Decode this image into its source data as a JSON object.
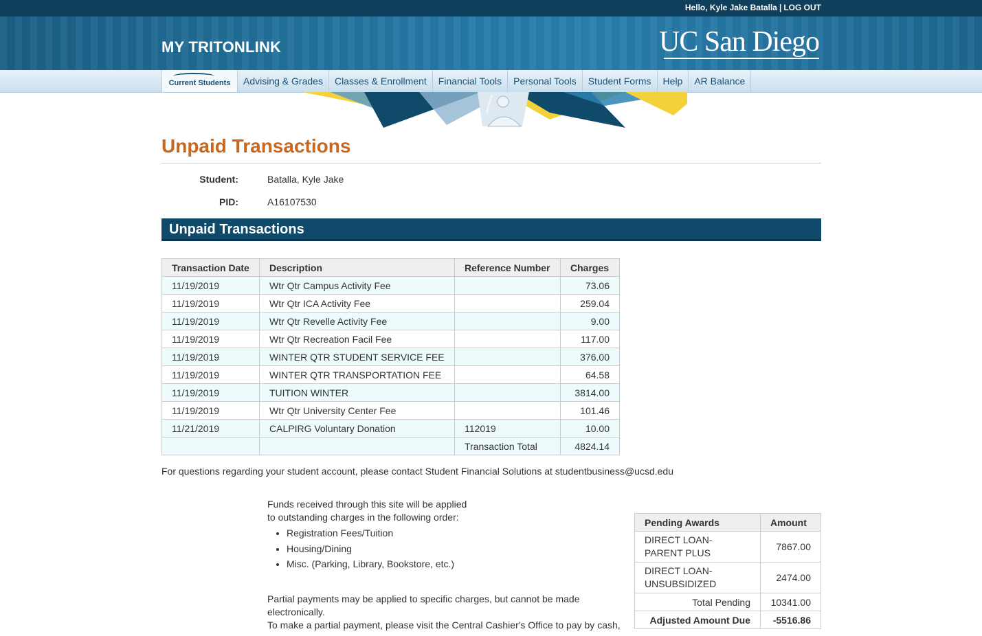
{
  "header": {
    "greeting": "Hello, Kyle Jake Batalla",
    "separator": "|",
    "logout": "LOG OUT",
    "app_title": "MY TRITONLINK",
    "logo_text": "UC San Diego"
  },
  "nav": {
    "items": [
      {
        "label": "Current Students"
      },
      {
        "label": "Advising & Grades"
      },
      {
        "label": "Classes & Enrollment"
      },
      {
        "label": "Financial Tools"
      },
      {
        "label": "Personal Tools"
      },
      {
        "label": "Student Forms"
      },
      {
        "label": "Help"
      },
      {
        "label": "AR Balance"
      }
    ]
  },
  "page": {
    "title": "Unpaid Transactions",
    "student_label": "Student:",
    "student_value": "Batalla, Kyle Jake",
    "pid_label": "PID:",
    "pid_value": "A16107530",
    "section_title": "Unpaid Transactions"
  },
  "transactions": {
    "headers": [
      "Transaction Date",
      "Description",
      "Reference Number",
      "Charges"
    ],
    "rows": [
      {
        "date": "11/19/2019",
        "description": "Wtr Qtr Campus Activity Fee",
        "reference": "",
        "charge": "73.06"
      },
      {
        "date": "11/19/2019",
        "description": "Wtr Qtr ICA Activity Fee",
        "reference": "",
        "charge": "259.04"
      },
      {
        "date": "11/19/2019",
        "description": "Wtr Qtr Revelle Activity Fee",
        "reference": "",
        "charge": "9.00"
      },
      {
        "date": "11/19/2019",
        "description": "Wtr Qtr Recreation Facil Fee",
        "reference": "",
        "charge": "117.00"
      },
      {
        "date": "11/19/2019",
        "description": "WINTER QTR STUDENT SERVICE FEE",
        "reference": "",
        "charge": "376.00"
      },
      {
        "date": "11/19/2019",
        "description": "WINTER QTR TRANSPORTATION FEE",
        "reference": "",
        "charge": "64.58"
      },
      {
        "date": "11/19/2019",
        "description": "TUITION WINTER",
        "reference": "",
        "charge": "3814.00"
      },
      {
        "date": "11/19/2019",
        "description": "Wtr Qtr University Center Fee",
        "reference": "",
        "charge": "101.46"
      },
      {
        "date": "11/21/2019",
        "description": "CALPIRG Voluntary Donation",
        "reference": "112019",
        "charge": "10.00"
      }
    ],
    "total_label": "Transaction Total",
    "total_value": "4824.14"
  },
  "contact_text": "For questions regarding your student account, please contact Student Financial Solutions at studentbusiness@ucsd.edu",
  "funds": {
    "line1": "Funds received through this site will be applied",
    "line2": "to outstanding charges in the following order:",
    "order": [
      "Registration Fees/Tuition",
      "Housing/Dining",
      "Misc. (Parking, Library, Bookstore, etc.)"
    ],
    "partial_line1": "Partial payments may be applied to specific charges, but cannot be made electronically.",
    "partial_line2": "To make a partial payment, please visit the Central Cashier's Office to pay by cash,"
  },
  "awards": {
    "headers": [
      "Pending Awards",
      "Amount"
    ],
    "rows": [
      {
        "line1": "DIRECT LOAN-",
        "line2": "PARENT PLUS",
        "amount": "7867.00"
      },
      {
        "line1": "DIRECT LOAN-",
        "line2": "UNSUBSIDIZED",
        "amount": "2474.00"
      }
    ],
    "total_pending_label": "Total Pending",
    "total_pending_value": "10341.00",
    "adjusted_label": "Adjusted Amount Due",
    "adjusted_value": "-5516.86"
  },
  "colors": {
    "top_bar": "#0f3f5a",
    "banner": "#2477a3",
    "title_orange": "#c8671d",
    "section_bar": "#0f4a6b",
    "row_tint": "#edfbfd"
  }
}
